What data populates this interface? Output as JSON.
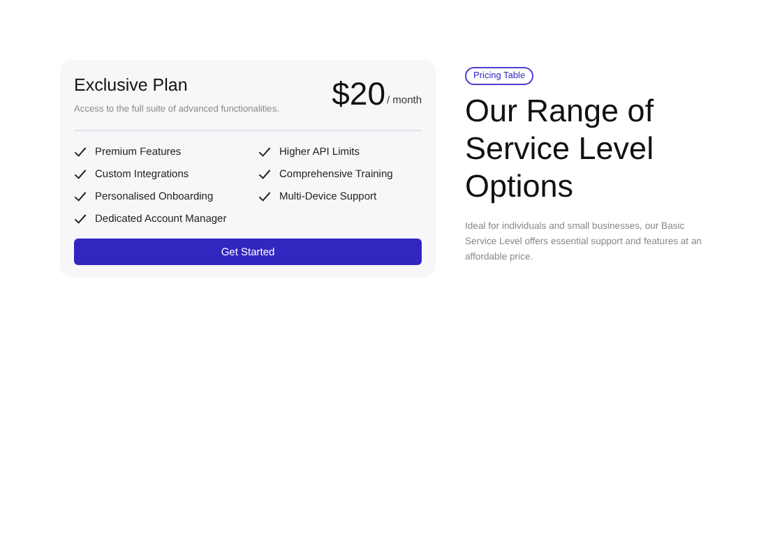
{
  "plan": {
    "name": "Exclusive Plan",
    "description": "Access to the full suite of advanced functionalities.",
    "price": "$20",
    "period": "/ month",
    "features": [
      "Premium Features",
      "Higher API Limits",
      "Custom Integrations",
      "Comprehensive Training",
      "Personalised Onboarding",
      "Multi-Device Support",
      "Dedicated Account Manager"
    ],
    "button": "Get Started"
  },
  "intro": {
    "badge": "Pricing Table",
    "heading": "Our Range of Service Level Options",
    "text": "Ideal for individuals and small businesses, our Basic Service Level offers essential support and features at an affordable price."
  }
}
